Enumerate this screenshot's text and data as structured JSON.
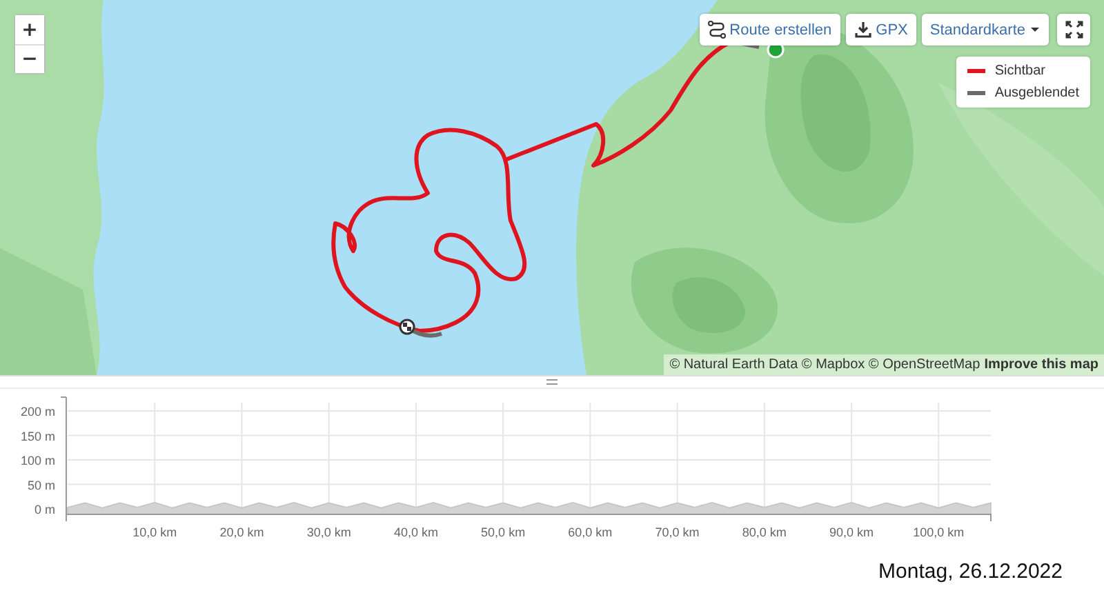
{
  "map": {
    "zoom_controls": [
      "+",
      "−"
    ],
    "toolbar": [
      {
        "kind": "route",
        "label": "Route erstellen"
      },
      {
        "kind": "download",
        "label": "GPX"
      },
      {
        "kind": "dropdown",
        "label": "Standardkarte"
      },
      {
        "kind": "fullscreen"
      }
    ],
    "legend": [
      {
        "label": "Sichtbar",
        "color": "#e0141e"
      },
      {
        "label": "Ausgeblendet",
        "color": "#6b6b6b"
      }
    ],
    "attribution": {
      "text": "© Natural Earth Data © Mapbox © OpenStreetMap",
      "link": "Improve this map"
    }
  },
  "elevation": {
    "chart_data": {
      "type": "area",
      "grid": true,
      "xlim": [
        0,
        106
      ],
      "ylim": [
        0,
        200
      ],
      "x": [
        0,
        2,
        4,
        6,
        8,
        10,
        12,
        14,
        16,
        18,
        20,
        22,
        24,
        26,
        28,
        30,
        32,
        34,
        36,
        38,
        40,
        42,
        44,
        46,
        48,
        50,
        52,
        54,
        56,
        58,
        60,
        62,
        64,
        66,
        68,
        70,
        72,
        74,
        76,
        78,
        80,
        82,
        84,
        86,
        88,
        90,
        92,
        94,
        96,
        98,
        100,
        102,
        104,
        106
      ],
      "values": [
        3,
        12,
        2,
        12,
        3,
        13,
        2,
        12,
        3,
        12,
        2,
        12,
        3,
        13,
        2,
        12,
        3,
        12,
        2,
        12,
        3,
        13,
        2,
        12,
        3,
        12,
        2,
        12,
        3,
        13,
        2,
        12,
        3,
        12,
        2,
        12,
        3,
        13,
        2,
        12,
        3,
        12,
        2,
        12,
        3,
        13,
        2,
        12,
        3,
        12,
        2,
        12,
        3,
        12
      ],
      "yticks": [
        {
          "value": 0,
          "label": "0 m"
        },
        {
          "value": 50,
          "label": "50 m"
        },
        {
          "value": 100,
          "label": "100 m"
        },
        {
          "value": 150,
          "label": "150 m"
        },
        {
          "value": 200,
          "label": "200 m"
        }
      ],
      "xticks": [
        {
          "value": 10,
          "label": "10,0 km"
        },
        {
          "value": 20,
          "label": "20,0 km"
        },
        {
          "value": 30,
          "label": "30,0 km"
        },
        {
          "value": 40,
          "label": "40,0 km"
        },
        {
          "value": 50,
          "label": "50,0 km"
        },
        {
          "value": 60,
          "label": "60,0 km"
        },
        {
          "value": 70,
          "label": "70,0 km"
        },
        {
          "value": 80,
          "label": "80,0 km"
        },
        {
          "value": 90,
          "label": "90,0 km"
        },
        {
          "value": 100,
          "label": "100,0 km"
        }
      ]
    }
  },
  "date": "Montag, 26.12.2022"
}
